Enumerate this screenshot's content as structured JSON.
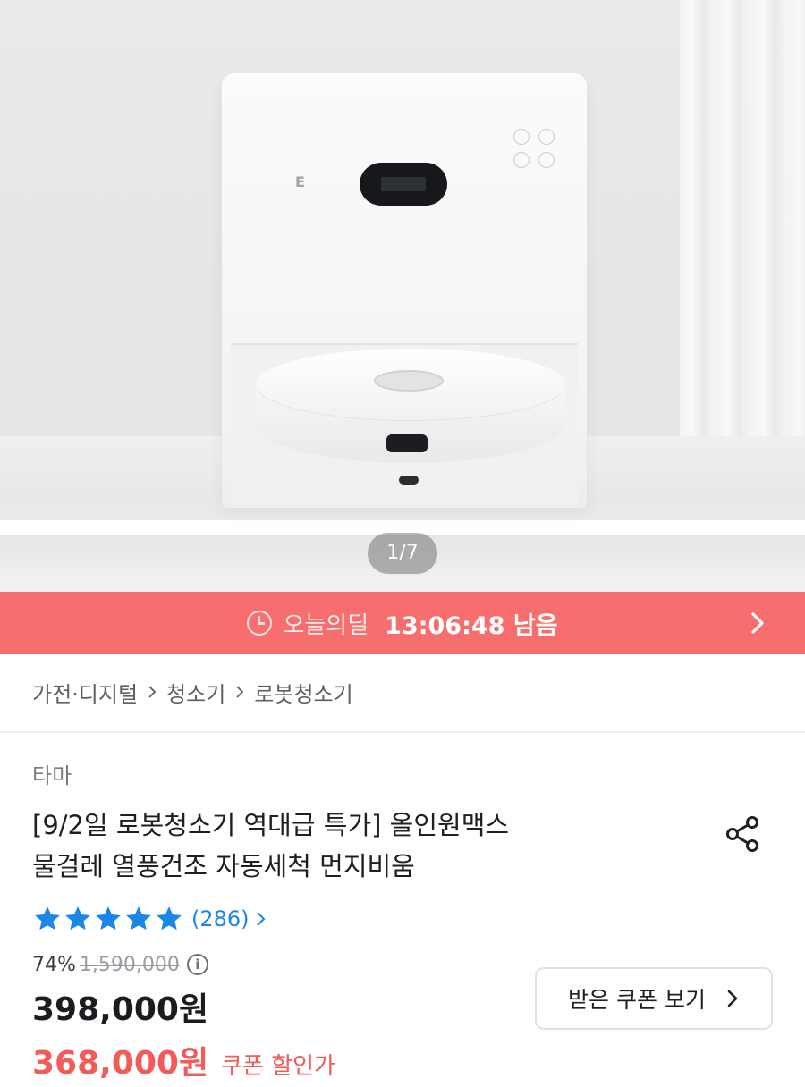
{
  "hero": {
    "image_alt": "robot vacuum with docking station",
    "station_logo": "E",
    "pager": "1/7"
  },
  "deal_banner": {
    "label": "오늘의딜",
    "countdown": "13:06:48 남음",
    "color": "#f76e6e"
  },
  "breadcrumb": [
    "가전·디지털",
    "청소기",
    "로봇청소기"
  ],
  "product": {
    "brand": "타마",
    "title_line1": "[9/2일 로봇청소기 역대급 특가] 올인원맥스",
    "title_line2": "물걸레 열풍건조 자동세척 먼지비움",
    "rating_stars": 5,
    "review_count": "(286)",
    "discount_pct": "74%",
    "original_price": "1,590,000",
    "price": "398,000원",
    "coupon_price": "368,000원",
    "coupon_label": "쿠폰 할인가",
    "coupon_button": "받은 쿠폰 보기"
  },
  "colors": {
    "accent_red": "#f25b57",
    "star_blue": "#1c86e6",
    "link_blue": "#1c86e6"
  }
}
